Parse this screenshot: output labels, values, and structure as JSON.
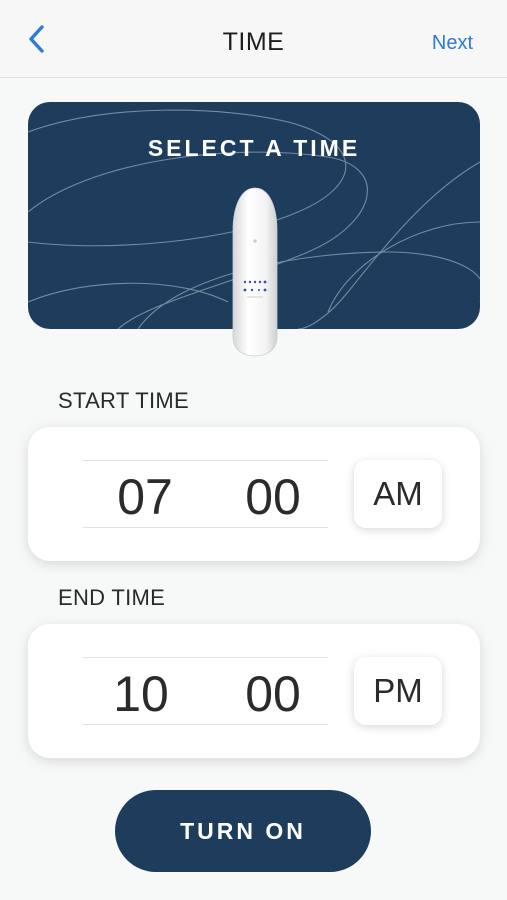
{
  "header": {
    "title": "TIME",
    "next_label": "Next",
    "back_icon": "chevron-left-icon"
  },
  "hero": {
    "title": "SELECT A TIME"
  },
  "start": {
    "label": "START TIME",
    "hour": "07",
    "minute": "00",
    "period": "AM"
  },
  "end": {
    "label": "END TIME",
    "hour": "10",
    "minute": "00",
    "period": "PM"
  },
  "action": {
    "label": "TURN ON"
  },
  "colors": {
    "brand_navy": "#1e3d5c",
    "link_blue": "#2f7ad8",
    "background": "#f7f8f8"
  }
}
